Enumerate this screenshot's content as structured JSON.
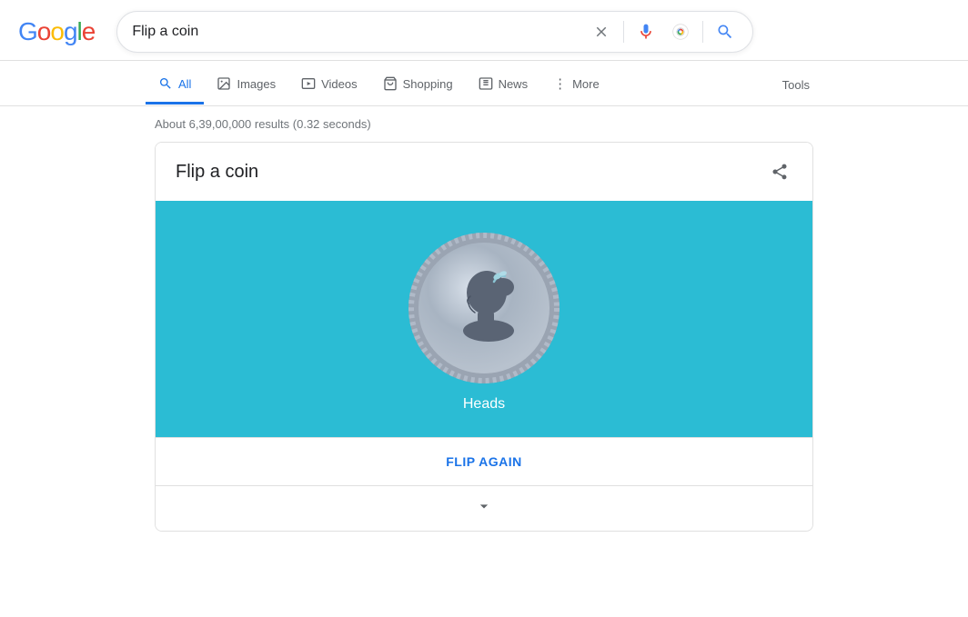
{
  "logo": {
    "letters": [
      {
        "char": "G",
        "color": "#4285F4"
      },
      {
        "char": "o",
        "color": "#EA4335"
      },
      {
        "char": "o",
        "color": "#FBBC05"
      },
      {
        "char": "g",
        "color": "#4285F4"
      },
      {
        "char": "l",
        "color": "#34A853"
      },
      {
        "char": "e",
        "color": "#EA4335"
      }
    ]
  },
  "search": {
    "query": "Flip a coin",
    "clear_label": "×",
    "search_label": "Search"
  },
  "nav": {
    "tabs": [
      {
        "id": "all",
        "label": "All",
        "icon": "🔍",
        "active": true
      },
      {
        "id": "images",
        "label": "Images",
        "icon": "🖼",
        "active": false
      },
      {
        "id": "videos",
        "label": "Videos",
        "icon": "▶",
        "active": false
      },
      {
        "id": "shopping",
        "label": "Shopping",
        "icon": "◇",
        "active": false
      },
      {
        "id": "news",
        "label": "News",
        "icon": "📰",
        "active": false
      },
      {
        "id": "more",
        "label": "More",
        "icon": "⋮",
        "active": false
      }
    ],
    "tools_label": "Tools"
  },
  "results": {
    "info": "About 6,39,00,000 results (0.32 seconds)"
  },
  "coin_flip": {
    "title": "Flip a coin",
    "result": "Heads",
    "flip_again_label": "FLIP AGAIN",
    "expand_icon": "chevron"
  }
}
